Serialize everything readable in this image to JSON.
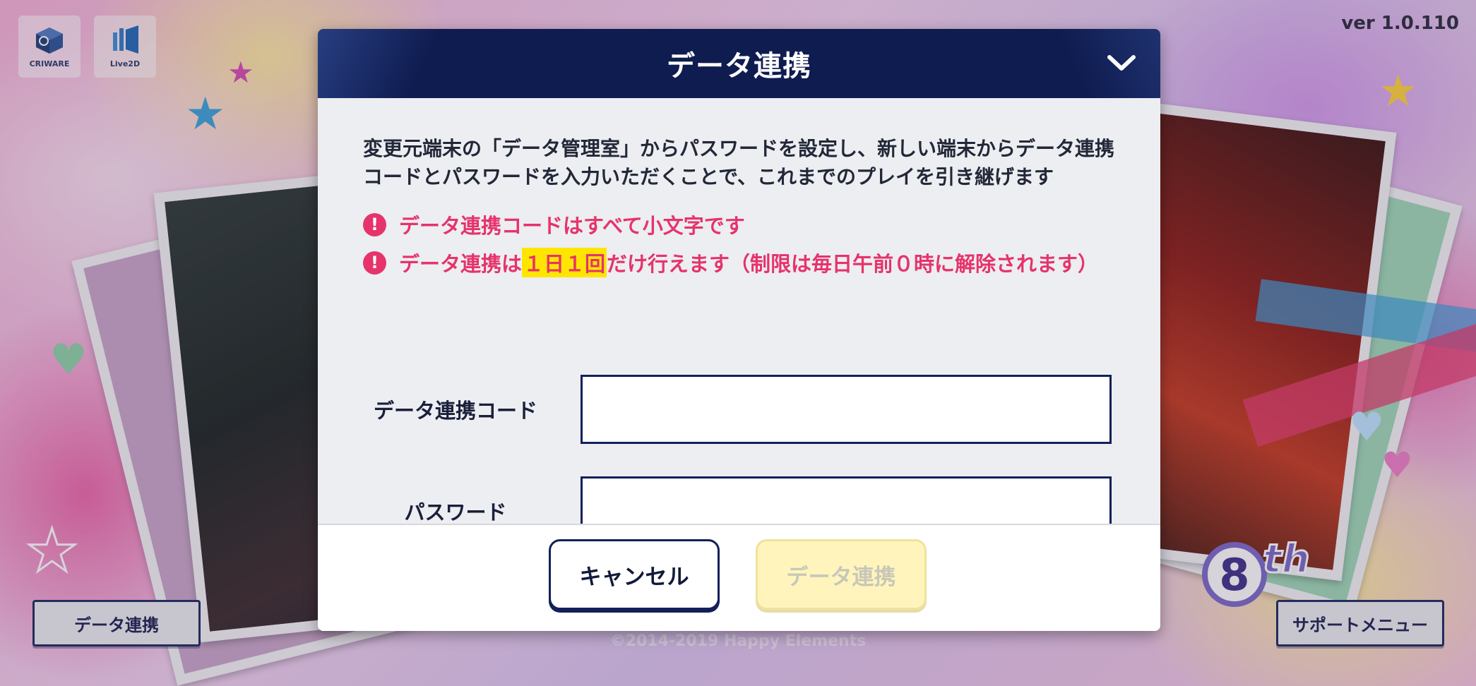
{
  "version": "ver 1.0.110",
  "logos": {
    "criware_label": "CRIWARE",
    "live2d_label": "Live2D"
  },
  "dialog": {
    "title": "データ連携",
    "description": "変更元端末の「データ管理室」からパスワードを設定し、新しい端末からデータ連携コードとパスワードを入力いただくことで、これまでのプレイを引き継げます",
    "warnings": [
      {
        "text": "データ連携コードはすべて小文字です"
      },
      {
        "before": "データ連携は",
        "highlight": "１日１回",
        "after": "だけ行えます（制限は毎日午前０時に解除されます）"
      }
    ],
    "fields": {
      "code_label": "データ連携コード",
      "code_value": "",
      "password_label": "パスワード",
      "password_value": ""
    },
    "buttons": {
      "cancel": "キャンセル",
      "submit": "データ連携"
    }
  },
  "bottom": {
    "data_link_button": "データ連携",
    "support_menu_button": "サポートメニュー",
    "copyright": "©2014-2019 Happy Elements"
  },
  "badge": {
    "number": "8",
    "suffix": "th"
  },
  "colors": {
    "header_navy": "#0f1c50",
    "warning_pink": "#e6336b",
    "highlight_yellow": "#ffe500",
    "disabled_button_bg": "#fff5bc"
  }
}
